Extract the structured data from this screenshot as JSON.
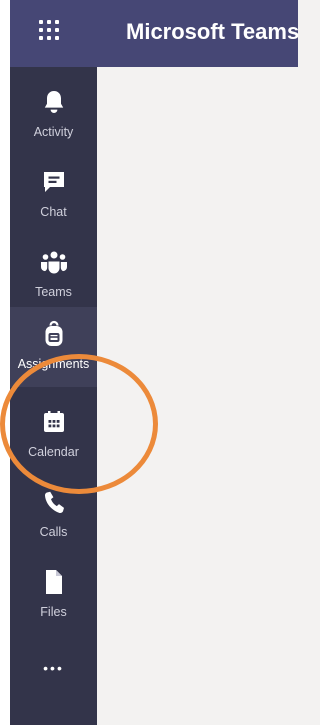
{
  "header": {
    "app_title": "Microsoft Teams",
    "app_launcher_icon": "waffle-grid-icon"
  },
  "rail": {
    "items": [
      {
        "label": "Activity",
        "icon": "bell-icon"
      },
      {
        "label": "Chat",
        "icon": "chat-icon"
      },
      {
        "label": "Teams",
        "icon": "teams-icon"
      },
      {
        "label": "Assignments",
        "icon": "backpack-icon",
        "active": true
      },
      {
        "label": "Calendar",
        "icon": "calendar-icon"
      },
      {
        "label": "Calls",
        "icon": "phone-icon"
      },
      {
        "label": "Files",
        "icon": "file-icon"
      }
    ],
    "more_glyph": "•••",
    "more_icon": "ellipsis-icon"
  },
  "colors": {
    "header_bg": "#464775",
    "rail_bg": "#33344a",
    "content_bg": "#f3f2f1",
    "annotation": "#ec8a3a"
  }
}
